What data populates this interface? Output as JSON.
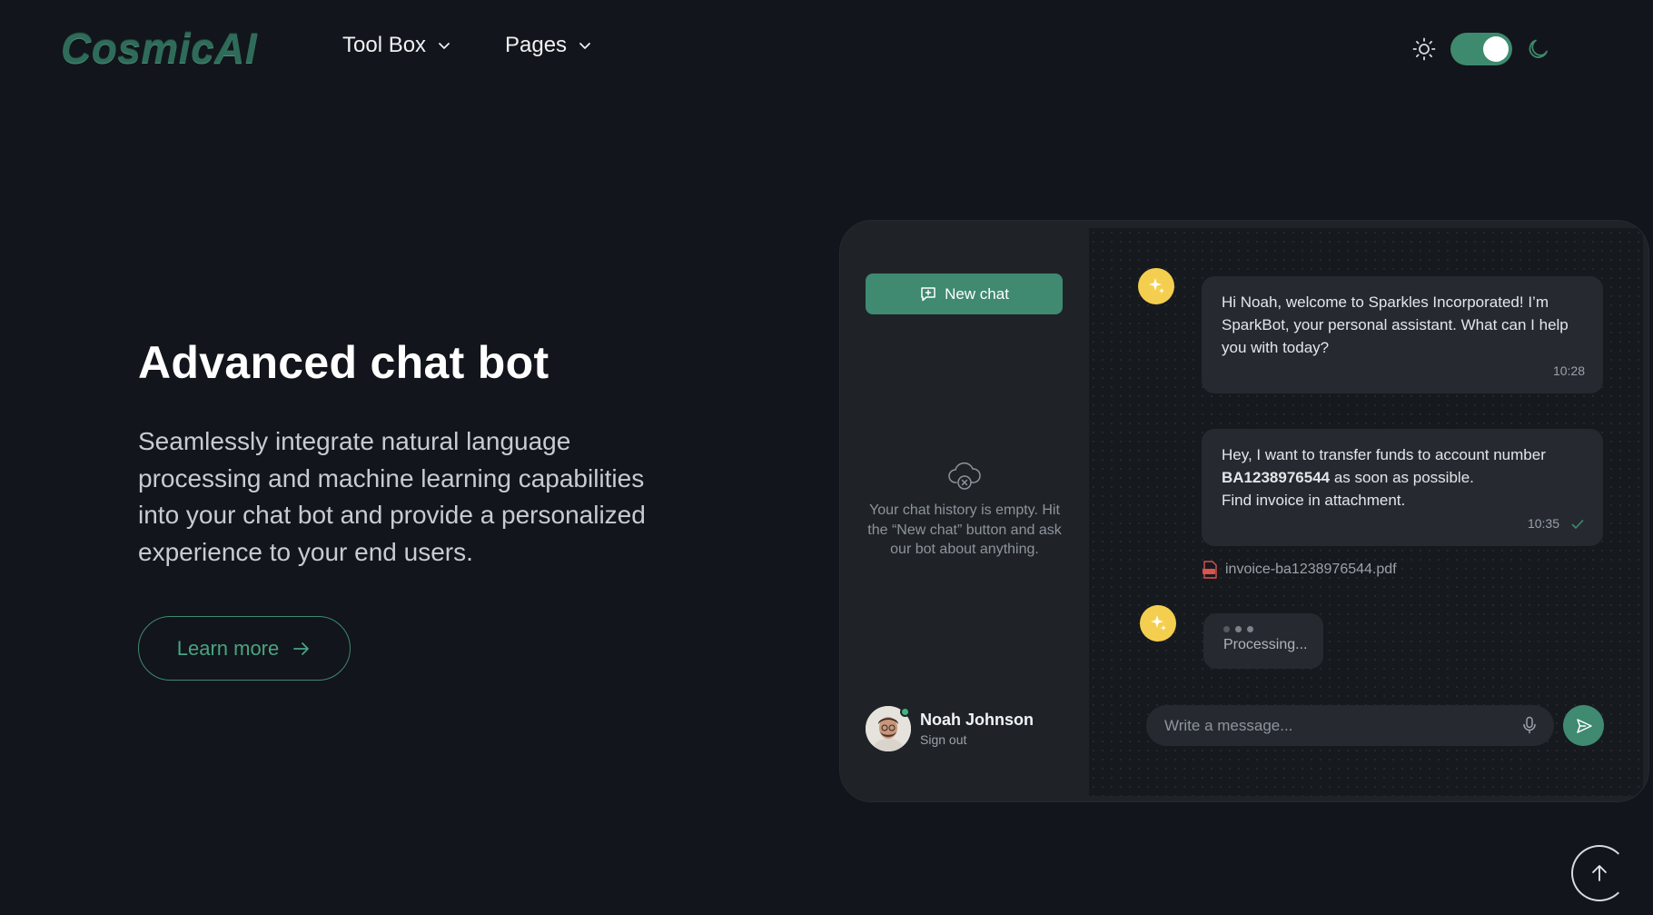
{
  "brand": {
    "logo_text": "CosmicAI"
  },
  "nav": {
    "items": [
      {
        "label": "Tool Box"
      },
      {
        "label": "Pages"
      }
    ]
  },
  "theme": {
    "mode": "dark",
    "toggle_on": true
  },
  "hero": {
    "title": "Advanced chat bot",
    "description": "Seamlessly integrate natural language processing and machine learning capabilities into your chat bot and provide a personalized experience to your end users.",
    "cta_label": "Learn more"
  },
  "chat": {
    "new_chat_label": "New chat",
    "empty_history_text": "Your chat history is empty. Hit the “New chat” button and ask our bot about anything.",
    "user": {
      "name": "Noah Johnson",
      "sign_out_label": "Sign out"
    },
    "messages": [
      {
        "from": "bot",
        "text": "Hi Noah, welcome to Sparkles Incorporated! I’m SparkBot, your personal assistant. What can I help you with today?",
        "time": "10:28"
      },
      {
        "from": "user",
        "text_before": "Hey, I want to transfer funds to account number ",
        "account": "BA1238976544",
        "text_after": " as soon as possible.",
        "line2": "Find invoice in attachment.",
        "time": "10:35",
        "attachment": "invoice-ba1238976544.pdf"
      }
    ],
    "processing_label": "Processing...",
    "input_placeholder": "Write a message...",
    "colors": {
      "accent": "#3f8a70",
      "bot_avatar": "#f4cf4f"
    }
  }
}
